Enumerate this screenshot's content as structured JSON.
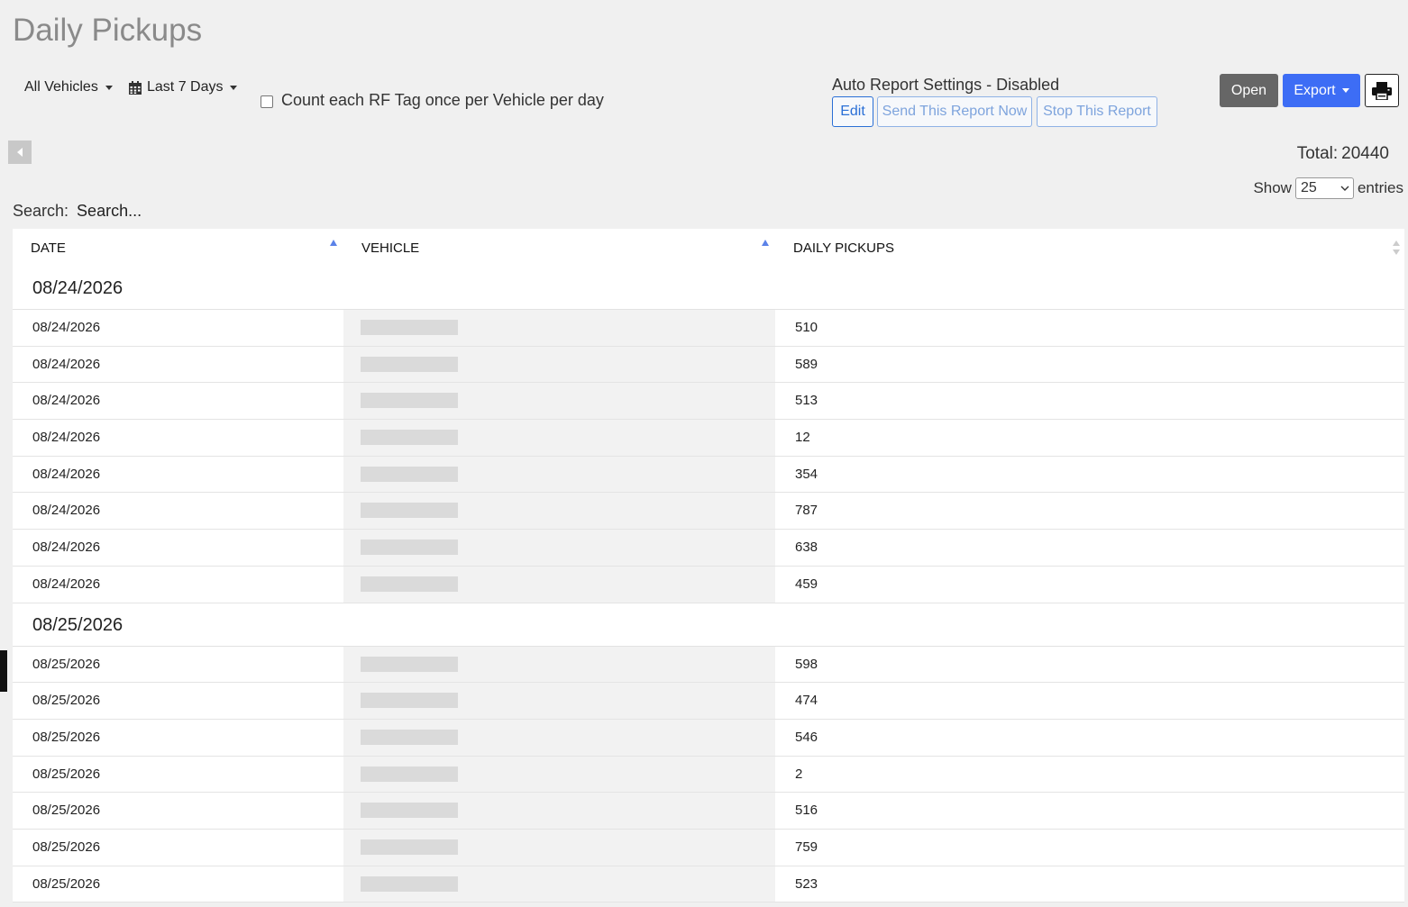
{
  "page": {
    "title": "Daily Pickups"
  },
  "filters": {
    "vehicles_label": "All Vehicles",
    "date_range_label": "Last 7 Days",
    "count_once_label": "Count each RF Tag once per Vehicle per day",
    "count_once_checked": false
  },
  "auto_report": {
    "title": "Auto Report Settings - Disabled",
    "edit_label": "Edit",
    "send_now_label": "Send This Report Now",
    "stop_label": "Stop This Report"
  },
  "actions": {
    "open_label": "Open",
    "export_label": "Export",
    "print_icon": "printer-icon"
  },
  "summary": {
    "total_label": "Total:",
    "total_value": "20440"
  },
  "length_menu": {
    "show_label": "Show",
    "page_size": "25",
    "entries_label": "entries"
  },
  "search": {
    "label": "Search:",
    "placeholder": "Search..."
  },
  "table": {
    "columns": [
      "DATE",
      "VEHICLE",
      "DAILY PICKUPS"
    ],
    "groups": [
      {
        "date": "08/24/2026",
        "rows": [
          {
            "date": "08/24/2026",
            "pickups": "510"
          },
          {
            "date": "08/24/2026",
            "pickups": "589"
          },
          {
            "date": "08/24/2026",
            "pickups": "513"
          },
          {
            "date": "08/24/2026",
            "pickups": "12"
          },
          {
            "date": "08/24/2026",
            "pickups": "354"
          },
          {
            "date": "08/24/2026",
            "pickups": "787"
          },
          {
            "date": "08/24/2026",
            "pickups": "638"
          },
          {
            "date": "08/24/2026",
            "pickups": "459"
          }
        ]
      },
      {
        "date": "08/25/2026",
        "rows": [
          {
            "date": "08/25/2026",
            "pickups": "598"
          },
          {
            "date": "08/25/2026",
            "pickups": "474"
          },
          {
            "date": "08/25/2026",
            "pickups": "546"
          },
          {
            "date": "08/25/2026",
            "pickups": "2"
          },
          {
            "date": "08/25/2026",
            "pickups": "516"
          },
          {
            "date": "08/25/2026",
            "pickups": "759"
          },
          {
            "date": "08/25/2026",
            "pickups": "523"
          }
        ]
      }
    ]
  }
}
